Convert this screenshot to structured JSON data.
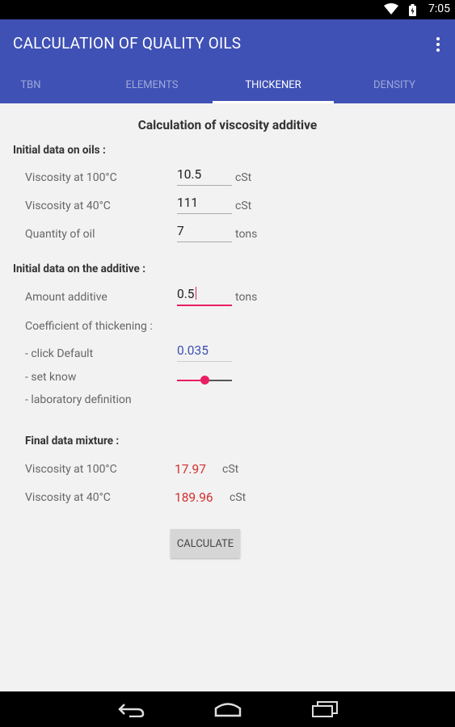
{
  "status": {
    "time": "7:05"
  },
  "app": {
    "title": "CALCULATION OF QUALITY OILS"
  },
  "tabs": [
    {
      "label": "TBN"
    },
    {
      "label": "ELEMENTS"
    },
    {
      "label": "THICKENER"
    },
    {
      "label": "DENSITY"
    }
  ],
  "heading": "Calculation of viscosity additive",
  "oils": {
    "section_title": "Initial data on oils :",
    "visc100": {
      "label": "Viscosity at 100°C",
      "value": "10.5",
      "unit": "cSt"
    },
    "visc40": {
      "label": "Viscosity at 40°C",
      "value": "111",
      "unit": "cSt"
    },
    "quantity": {
      "label": "Quantity of oil",
      "value": "7",
      "unit": "tons"
    }
  },
  "additive": {
    "section_title": "Initial data on the additive :",
    "amount": {
      "label": "Amount additive",
      "value": "0.5",
      "unit": "tons"
    },
    "coefficient_title": "Coefficient of thickening :",
    "click_default": {
      "label": "- click Default",
      "value": "0.035"
    },
    "set_know": {
      "label": "- set know",
      "slider_value": 0.5
    },
    "lab_definition": {
      "label": "- laboratory definition"
    }
  },
  "final": {
    "section_title": "Final data mixture :",
    "visc100": {
      "label": "Viscosity at 100°C",
      "value": "17.97",
      "unit": "cSt"
    },
    "visc40": {
      "label": "Viscosity at 40°C",
      "value": "189.96",
      "unit": "cSt"
    }
  },
  "calculate_label": "CALCULATE",
  "colors": {
    "primary": "#3f51b5",
    "accent": "#e91e63",
    "result": "#d32f2f"
  }
}
